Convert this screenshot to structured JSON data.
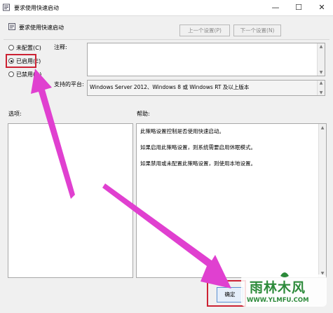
{
  "window": {
    "title": "要求使用快速启动",
    "minimize_glyph": "—",
    "maximize_glyph": "☐",
    "close_glyph": "✕"
  },
  "header": {
    "setting_name": "要求使用快速启动",
    "prev_button": "上一个设置(P)",
    "next_button": "下一个设置(N)"
  },
  "state": {
    "options": [
      {
        "label": "未配置(C)",
        "selected": false
      },
      {
        "label": "已启用(E)",
        "selected": true
      },
      {
        "label": "已禁用(D)",
        "selected": false
      }
    ]
  },
  "comment": {
    "label": "注释:",
    "value": ""
  },
  "supported": {
    "label": "支持的平台:",
    "value": "Windows Server 2012、Windows 8 或 Windows RT 及以上版本"
  },
  "options_panel": {
    "label": "选项:"
  },
  "help_panel": {
    "label": "帮助:",
    "paragraphs": [
      "此策略设置控制是否使用快速启动。",
      "如果启用此策略设置，则系统需要启用休眠模式。",
      "如果禁用或未配置此策略设置，则使用本地设置。"
    ]
  },
  "footer": {
    "ok_button": "确定"
  },
  "watermark": {
    "main": "雨林木风",
    "url": "WWW.YLMFU.COM"
  },
  "colors": {
    "annotation_arrow": "#e040d0",
    "annotation_box": "#cc2233",
    "watermark": "#2c8a3a"
  }
}
